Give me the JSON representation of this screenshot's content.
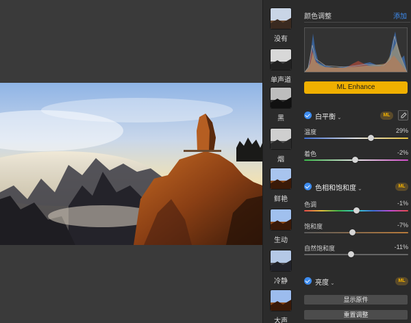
{
  "filters": [
    {
      "label": "没有",
      "style": "color"
    },
    {
      "label": "单声道",
      "style": "mono"
    },
    {
      "label": "黑",
      "style": "dark"
    },
    {
      "label": "烟",
      "style": "smoke"
    },
    {
      "label": "鲜艳",
      "style": "vivid"
    },
    {
      "label": "生动",
      "style": "vivid"
    },
    {
      "label": "冷静",
      "style": "cool"
    },
    {
      "label": "大声",
      "style": "vivid"
    }
  ],
  "panel": {
    "title": "颜色调整",
    "add_label": "添加",
    "ml_enhance_label": "ML Enhance",
    "white_balance": {
      "title": "白平衡",
      "badge": "ML",
      "sliders": [
        {
          "label": "温度",
          "value": "29%",
          "position": 0.64
        },
        {
          "label": "着色",
          "value": "-2%",
          "position": 0.49
        }
      ]
    },
    "hue_saturation": {
      "title": "色相和饱和度",
      "badge": "ML",
      "sliders": [
        {
          "label": "色调",
          "value": "-1%",
          "position": 0.5
        },
        {
          "label": "饱和度",
          "value": "-7%",
          "position": 0.46
        },
        {
          "label": "自然饱和度",
          "value": "-11%",
          "position": 0.45
        }
      ]
    },
    "brightness": {
      "title": "亮度",
      "badge": "ML"
    },
    "show_original_label": "显示原件",
    "reset_label": "重置调整"
  },
  "colors": {
    "accent_blue": "#3d8cf0",
    "ml_yellow": "#f0b000"
  }
}
